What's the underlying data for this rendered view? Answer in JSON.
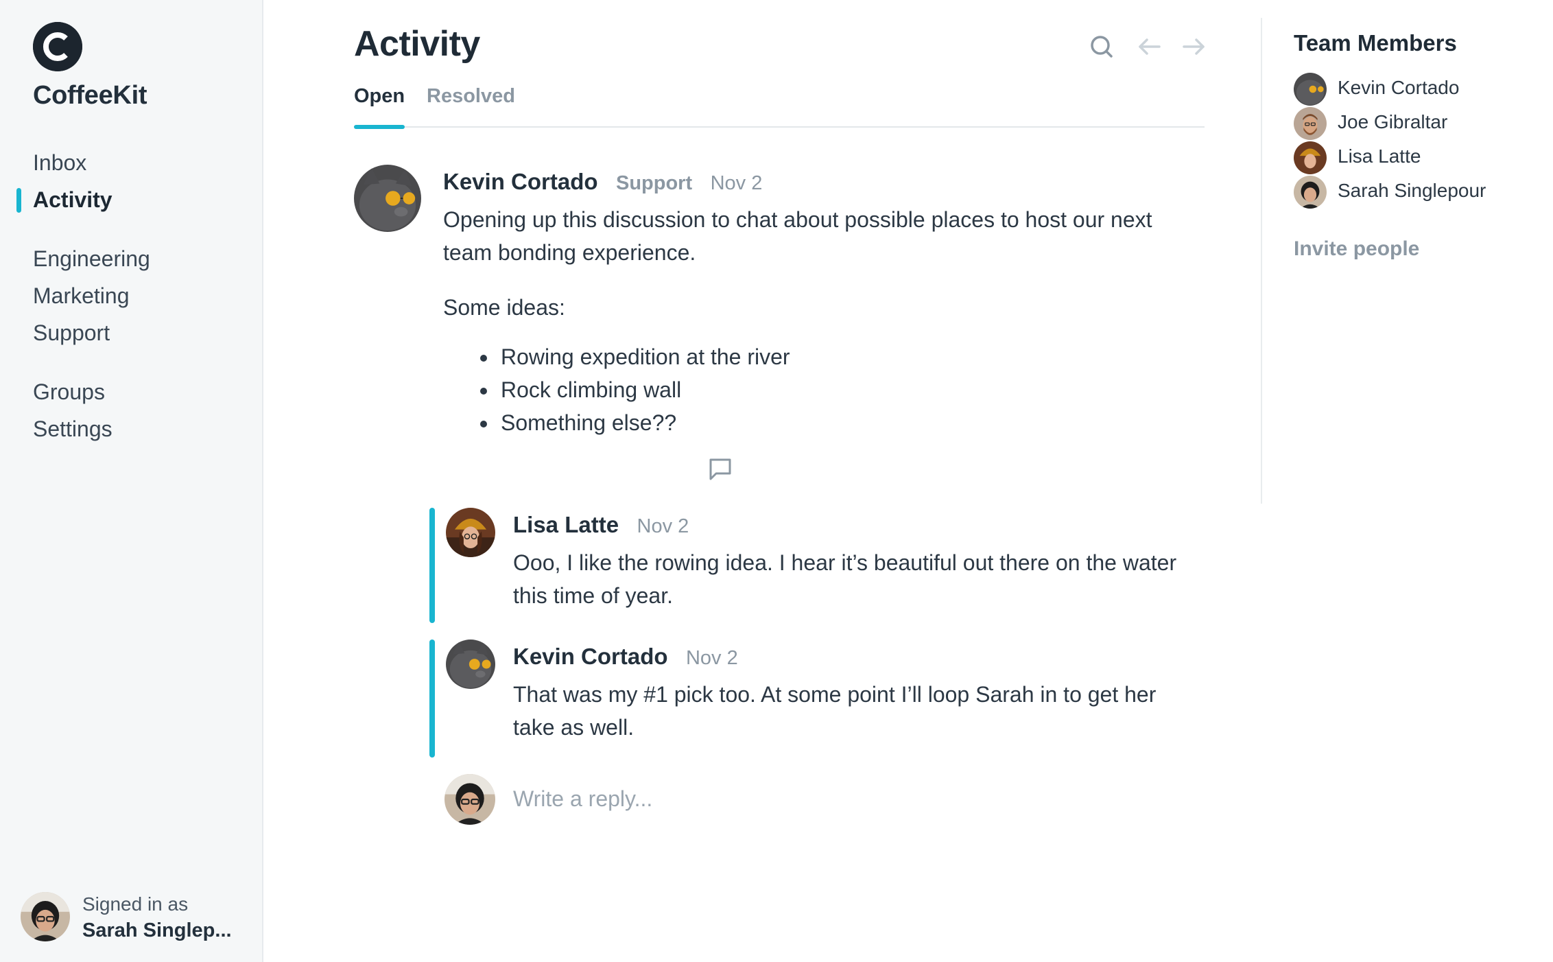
{
  "app": {
    "brand": "CoffeeKit",
    "logo_letter": "C",
    "accent_color": "#19b5d0"
  },
  "sidebar": {
    "primary": [
      {
        "label": "Inbox",
        "active": false
      },
      {
        "label": "Activity",
        "active": true
      }
    ],
    "teams": [
      {
        "label": "Engineering"
      },
      {
        "label": "Marketing"
      },
      {
        "label": "Support"
      }
    ],
    "misc": [
      {
        "label": "Groups"
      },
      {
        "label": "Settings"
      }
    ],
    "signed_in": {
      "caption": "Signed in as",
      "name": "Sarah Singlep..."
    }
  },
  "main": {
    "title": "Activity",
    "icons": [
      "search-icon",
      "arrow-left-icon",
      "arrow-right-icon"
    ],
    "tabs": [
      {
        "label": "Open",
        "active": true
      },
      {
        "label": "Resolved",
        "active": false
      }
    ],
    "post": {
      "author": "Kevin Cortado",
      "tag": "Support",
      "date": "Nov 2",
      "paragraph1": "Opening up this discussion to chat about possible places to host our next team bonding experience.",
      "paragraph2": "Some ideas:",
      "ideas": [
        "Rowing expedition at the river",
        "Rock climbing wall",
        "Something else??"
      ],
      "comment_icon": "comment-icon"
    },
    "replies": [
      {
        "author": "Lisa Latte",
        "date": "Nov 2",
        "text": "Ooo, I like the rowing idea. I hear it’s beautiful out there on the water this time of year."
      },
      {
        "author": "Kevin Cortado",
        "date": "Nov 2",
        "text": "That was my #1 pick too. At some point I’ll loop Sarah in to get her take as well."
      }
    ],
    "reply_box": {
      "placeholder": "Write a reply..."
    }
  },
  "right_panel": {
    "title": "Team Members",
    "members": [
      {
        "name": "Kevin Cortado"
      },
      {
        "name": "Joe Gibraltar"
      },
      {
        "name": "Lisa Latte"
      },
      {
        "name": "Sarah Singlepour"
      }
    ],
    "invite_label": "Invite people"
  }
}
